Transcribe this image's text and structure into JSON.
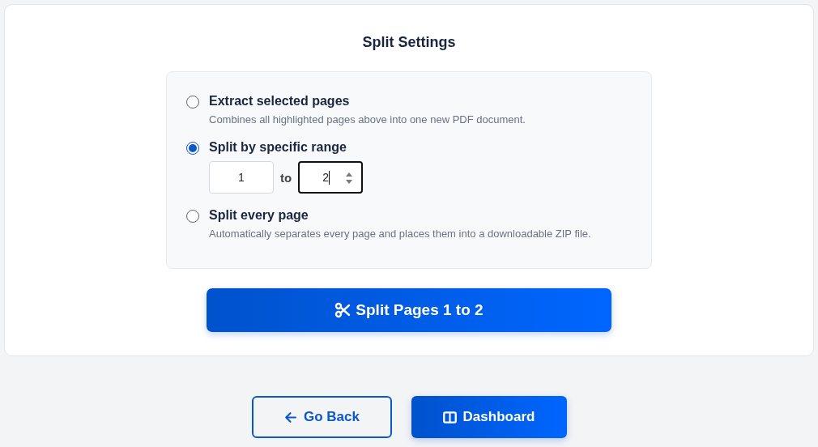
{
  "settings": {
    "title": "Split Settings",
    "options": [
      {
        "kind": "plain",
        "label": "Extract selected pages",
        "description": "Combines all highlighted pages above into one new PDF document.",
        "selected": false
      },
      {
        "kind": "range",
        "label": "Split by specific range",
        "selected": true,
        "range": {
          "from": "1",
          "separator": "to",
          "to": "2",
          "to_focused": true
        }
      },
      {
        "kind": "plain",
        "label": "Split every page",
        "description": "Automatically separates every page and places them into a downloadable ZIP file.",
        "selected": false
      }
    ],
    "action": {
      "label": "Split Pages 1 to 2"
    }
  },
  "footer": {
    "back": {
      "label": "Go Back"
    },
    "dashboard": {
      "label": "Dashboard"
    }
  }
}
